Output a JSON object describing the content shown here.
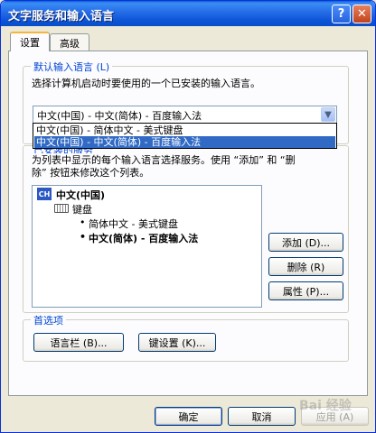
{
  "window": {
    "title": "文字服务和输入语言",
    "help_label": "?",
    "close_label": "✕"
  },
  "tabs": [
    {
      "label": "设置"
    },
    {
      "label": "高级"
    }
  ],
  "default_language": {
    "group_label": "默认输入语言 (L)",
    "description": "选择计算机启动时要使用的一个已安装的输入语言。",
    "selected_value": "中文(中国) - 中文(简体) - 百度输入法",
    "options": [
      "中文(中国) - 简体中文 - 美式键盘",
      "中文(中国) - 中文(简体) - 百度输入法"
    ],
    "highlighted_index": 1
  },
  "installed_services": {
    "group_label_partial": "已安装的服务",
    "description_line1": "为列表中显示的每个输入语言选择服务。使用 “添加” 和 “删",
    "description_line2": "除” 按钮来修改这个列表。",
    "tree": {
      "language_icon": "CH",
      "language": "中文(中国)",
      "category": "键盘",
      "items": [
        {
          "bullet": "•",
          "label": "简体中文 - 美式键盘",
          "bold": false
        },
        {
          "bullet": "•",
          "label": "中文(简体) - 百度输入法",
          "bold": true
        }
      ]
    },
    "buttons": {
      "add": "添加 (D)...",
      "remove": "删除 (R)",
      "properties": "属性 (P)..."
    }
  },
  "preferences": {
    "group_label": "首选项",
    "language_bar_button": "语言栏 (B)...",
    "key_settings_button": "键设置 (K)..."
  },
  "footer": {
    "ok": "确定",
    "cancel": "取消",
    "apply": "应用 (A)"
  },
  "watermark": "Bai 经验",
  "colors": {
    "title_blue": "#0a5bd8",
    "selection": "#316ac5",
    "group_label": "#0046d5"
  }
}
